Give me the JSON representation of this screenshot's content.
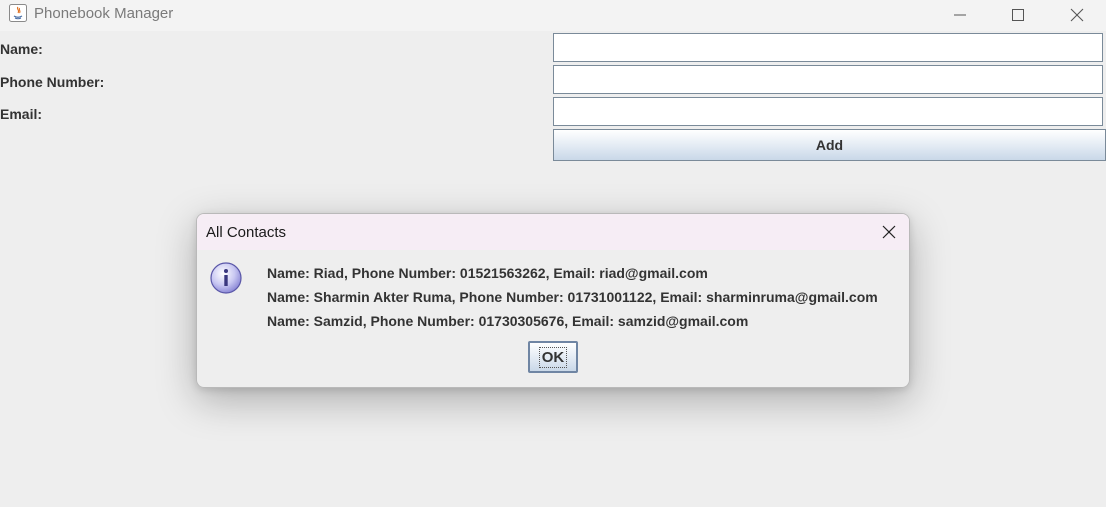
{
  "window": {
    "title": "Phonebook Manager"
  },
  "form": {
    "name_label": "Name:",
    "phone_label": "Phone Number:",
    "email_label": "Email:",
    "name_value": "",
    "phone_value": "",
    "email_value": "",
    "add_label": "Add"
  },
  "dialog": {
    "title": "All Contacts",
    "icon": "info-icon",
    "lines": [
      "Name: Riad, Phone Number: 01521563262, Email: riad@gmail.com",
      "Name: Sharmin Akter Ruma, Phone Number: 01731001122, Email: sharminruma@gmail.com",
      "Name: Samzid, Phone Number: 01730305676, Email: samzid@gmail.com"
    ],
    "ok_label": "OK"
  },
  "colors": {
    "background": "#eeeeee",
    "dialog_titlebar": "#f6edf5",
    "button_border": "#7a8a99"
  }
}
